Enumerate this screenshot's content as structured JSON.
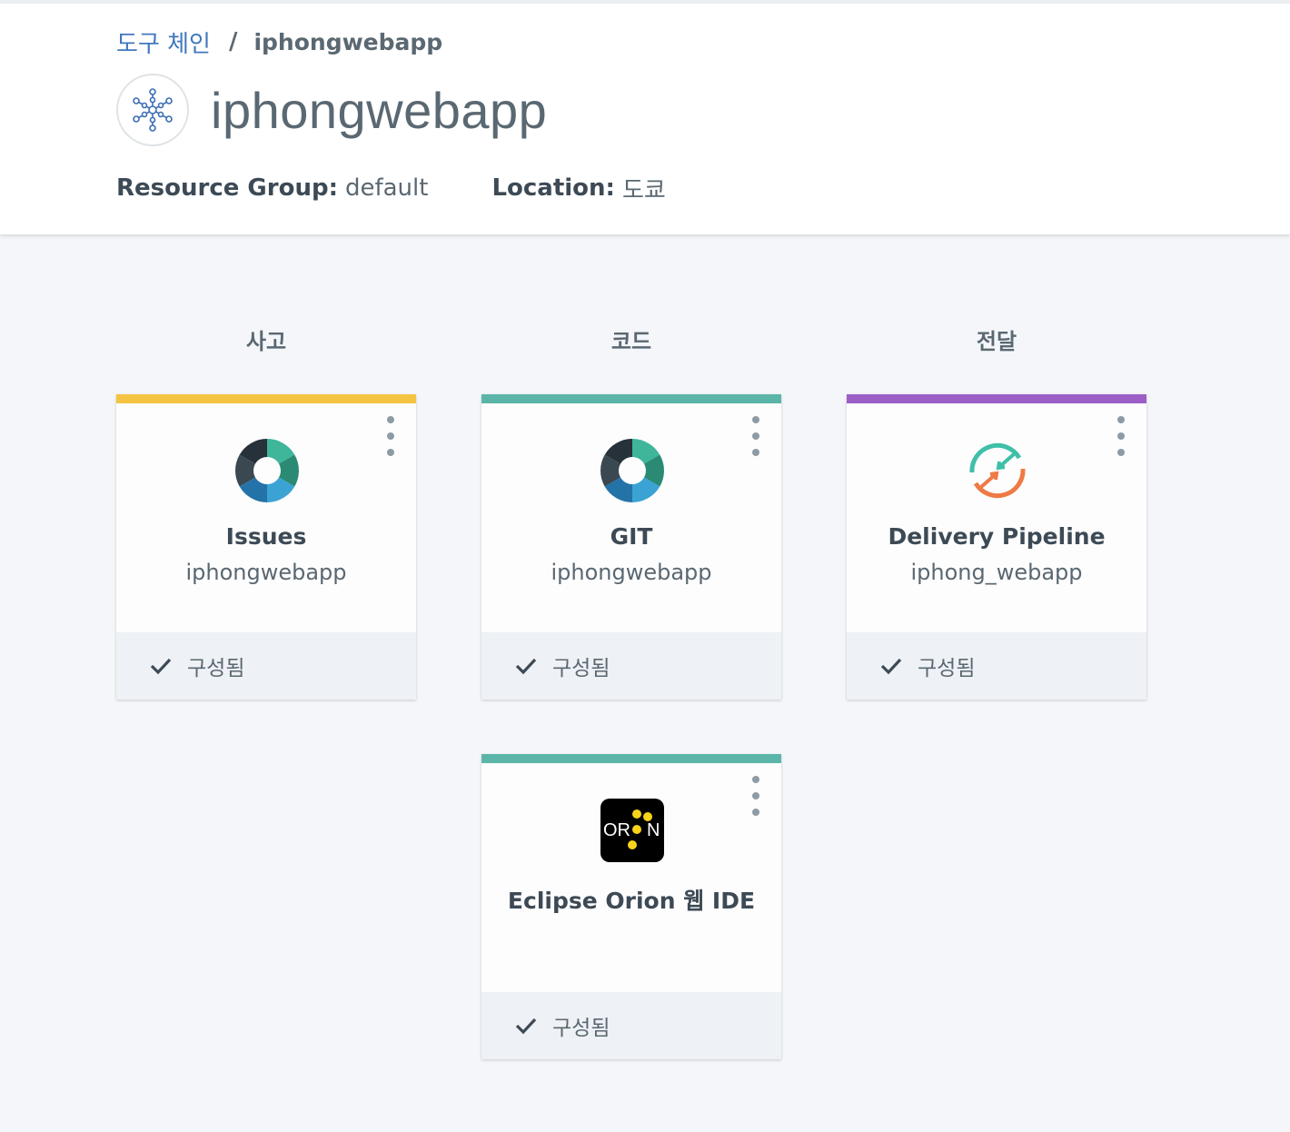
{
  "breadcrumb": {
    "parent": "도구 체인",
    "separator": "/",
    "current": "iphongwebapp"
  },
  "header": {
    "title": "iphongwebapp",
    "icon": "toolchain-network-icon",
    "resource_group_label": "Resource Group:",
    "resource_group_value": "default",
    "location_label": "Location:",
    "location_value": "도쿄"
  },
  "columns": [
    {
      "heading": "사고"
    },
    {
      "heading": "코드"
    },
    {
      "heading": "전달"
    }
  ],
  "cards": [
    {
      "name": "Issues",
      "sub": "iphongwebapp",
      "status": "구성됨",
      "accent": "#f5c342",
      "icon": "git-ring-icon"
    },
    {
      "name": "GIT",
      "sub": "iphongwebapp",
      "status": "구성됨",
      "accent": "#5bb5a9",
      "icon": "git-ring-icon"
    },
    {
      "name": "Delivery Pipeline",
      "sub": "iphong_webapp",
      "status": "구성됨",
      "accent": "#9b5fc7",
      "icon": "delivery-pipeline-icon"
    },
    {
      "name": "Eclipse Orion 웹 IDE",
      "sub": "",
      "status": "구성됨",
      "accent": "#5bb5a9",
      "icon": "orion-icon"
    }
  ],
  "orion_logo": {
    "left": "OR",
    "right": "N"
  },
  "colors": {
    "link": "#4178be",
    "background": "#f4f6f9",
    "footer": "#eef1f5"
  }
}
